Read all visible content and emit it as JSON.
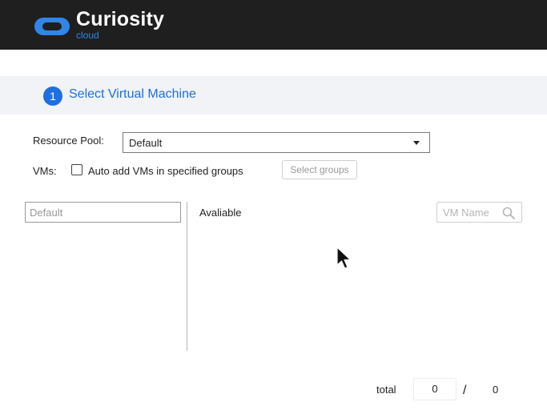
{
  "header": {
    "brand_name": "Curiosity",
    "brand_sub": "cloud",
    "logo_icon": "curiosity-cloud-logo",
    "brand_color": "#2f86e8",
    "bar_color": "#1f1f1f"
  },
  "step": {
    "number": "1",
    "title": "Select Virtual Machine",
    "accent": "#1e6fe0"
  },
  "form": {
    "resource_pool_label": "Resource Pool:",
    "resource_pool_value": "Default",
    "vms_label": "VMs:",
    "auto_add_label": "Auto add VMs in specified groups",
    "auto_add_checked": false,
    "select_groups_label": "Select groups"
  },
  "panel": {
    "left_placeholder": "Default",
    "available_label": "Avaliable",
    "search_placeholder": "VM Name",
    "search_icon": "search-icon"
  },
  "footer": {
    "total_label": "total",
    "selected_count": "0",
    "separator": "/",
    "total_count": "0"
  }
}
